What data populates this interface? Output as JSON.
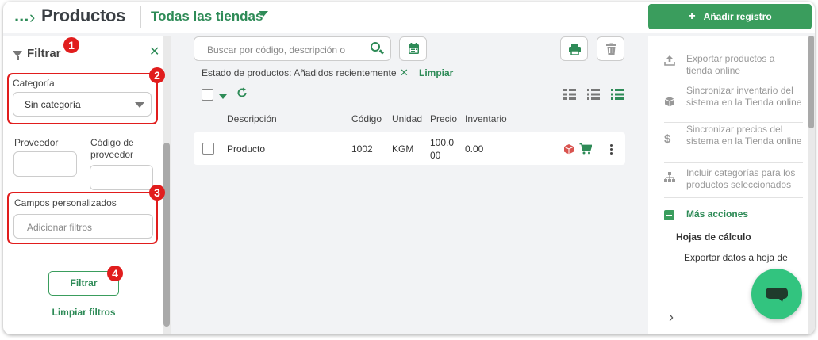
{
  "header": {
    "breadcrumb_ellipsis": "...",
    "title": "Productos",
    "store_selector": "Todas las tiendas",
    "add_button": "Añadir registro"
  },
  "filters": {
    "title": "Filtrar",
    "category_label": "Categoría",
    "category_value": "Sin categoría",
    "supplier_label": "Proveedor",
    "supplier_code_label": "Código de proveedor",
    "custom_fields_label": "Campos personalizados",
    "custom_fields_placeholder": "Adicionar filtros",
    "filter_button": "Filtrar",
    "clear_filters": "Limpiar filtros"
  },
  "annotations": [
    "1",
    "2",
    "3",
    "4"
  ],
  "toolbar": {
    "search_placeholder": "Buscar por código, descripción o",
    "state_text": "Estado de productos: Añadidos recientemente",
    "state_remove": "✕",
    "state_clear": "Limpiar"
  },
  "table": {
    "columns": [
      "Descripción",
      "Código",
      "Unidad",
      "Precio",
      "Inventario"
    ],
    "rows": [
      {
        "description": "Producto",
        "code": "1002",
        "unit": "KGM",
        "price_line1": "100.0",
        "price_line2": "00",
        "inventory": "0.00"
      }
    ]
  },
  "actions": {
    "items": [
      {
        "icon": "upload-icon",
        "label": "Exportar productos a tienda online"
      },
      {
        "icon": "box-icon",
        "label": "Sincronizar inventario del sistema en la Tienda online"
      },
      {
        "icon": "dollar-icon",
        "label": "Sincronizar precios del sistema en la Tienda online"
      },
      {
        "icon": "hierarchy-icon",
        "label": "Incluir categorías para los productos seleccionados"
      }
    ],
    "more_actions": "Más acciones",
    "spreadsheets": "Hojas de cálculo",
    "export_spreadsheet": "Exportar datos a hoja de"
  },
  "colors": {
    "accent": "#2e8b57",
    "button": "#3a9d5d",
    "annotation": "#e11d1d",
    "chat": "#32c47f"
  }
}
